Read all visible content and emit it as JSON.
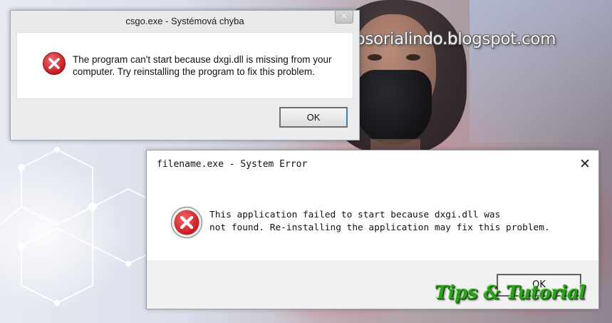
{
  "watermark": {
    "site": "mastertipsorialindo.blogspot.com",
    "tips": "Tips & Tutorial"
  },
  "dialog_top": {
    "title": "csgo.exe - Systémová chyba",
    "close_glyph": "✕",
    "message": "The program can't start because dxgi.dll is missing from your computer. Try reinstalling the program to fix this problem.",
    "ok_label": "OK",
    "icon": "error-icon"
  },
  "dialog_bottom": {
    "title": "filename.exe - System Error",
    "close_glyph": "✕",
    "message": "This application failed to start because dxgi.dll was\nnot found. Re-installing the application may fix this problem.",
    "ok_label": "OK",
    "icon": "error-icon"
  },
  "colors": {
    "error_red": "#d8262b",
    "ok_focus_border": "#3c7fb1",
    "tips_green": "#2f9e1e"
  }
}
